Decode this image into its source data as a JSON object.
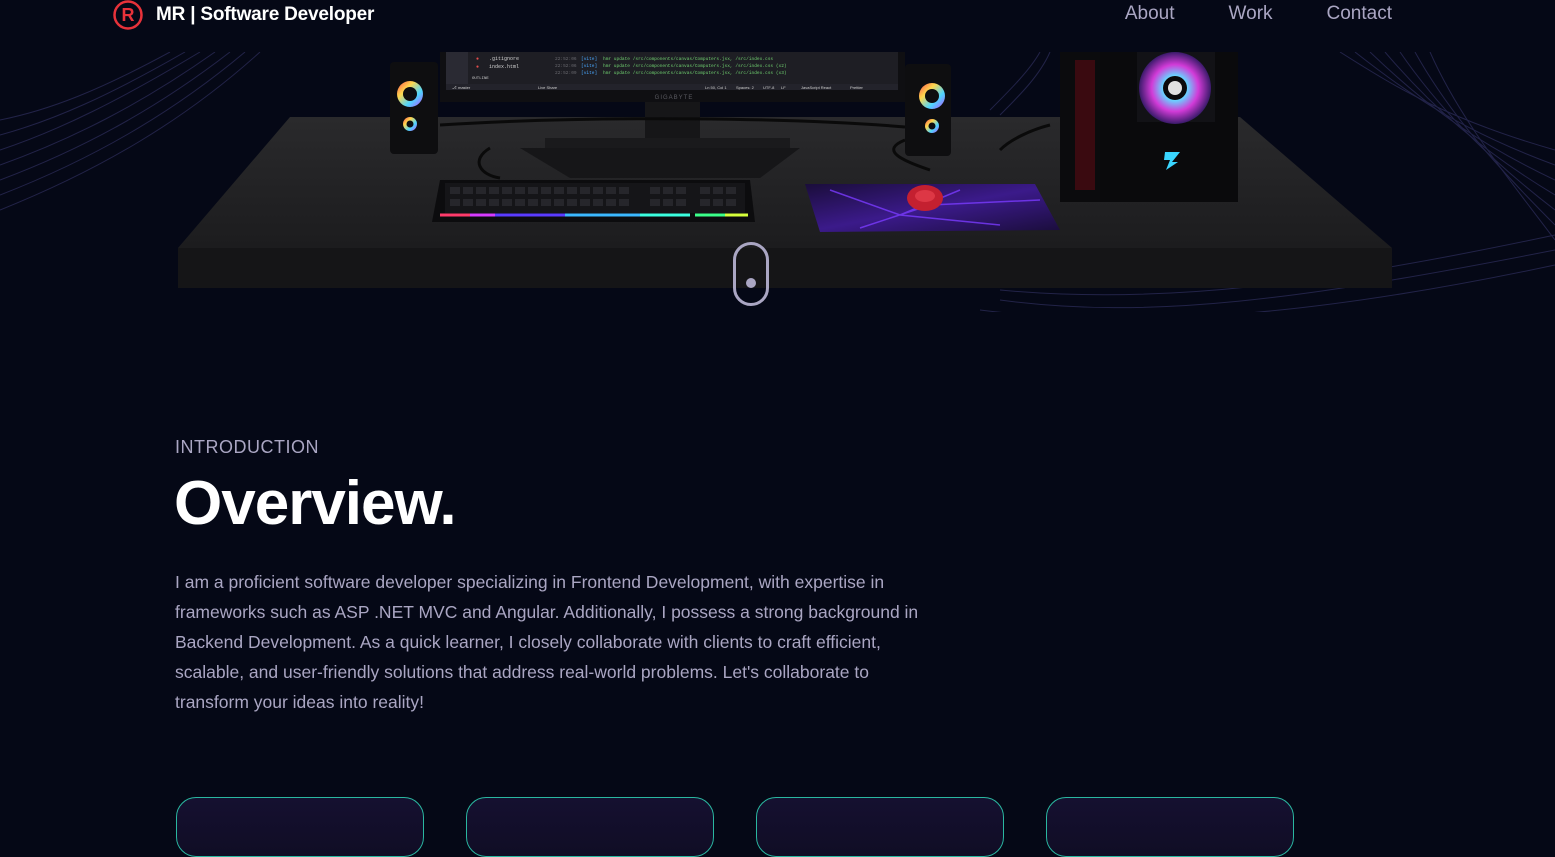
{
  "brand": {
    "logo_letter": "R",
    "initials": "MR",
    "title": " | Software Developer",
    "accent_color": "#e8323a"
  },
  "nav": {
    "links": [
      "About",
      "Work",
      "Contact"
    ]
  },
  "monitor": {
    "vendor": "GIGABYTE",
    "files": [
      ".gitignore",
      "index.html"
    ],
    "panel_label": "OUTLINE",
    "branch": "master",
    "live_share": "Live Share",
    "status_items": [
      "Ln 50, Col 1",
      "Spaces: 2",
      "UTF-8",
      "LF",
      "JavaScript React",
      "Prettier"
    ],
    "log_lines": [
      {
        "time": "22:52:06",
        "tag": "[vite]",
        "msg": "hmr update /src/components/canvas/Computers.jsx, /src/index.css"
      },
      {
        "time": "22:52:06",
        "tag": "[vite]",
        "msg": "hmr update /src/components/canvas/Computers.jsx, /src/index.css (x2)"
      },
      {
        "time": "22:52:09",
        "tag": "[vite]",
        "msg": "hmr update /src/components/canvas/Computers.jsx, /src/index.css (x3)"
      }
    ]
  },
  "introduction": {
    "label": "INTRODUCTION",
    "title": "Overview.",
    "text": "I am a proficient software developer specializing in Frontend Development, with expertise in frameworks such as ASP .NET MVC and Angular. Additionally, I possess a strong background in Backend Development. As a quick learner, I closely collaborate with clients to craft efficient, scalable, and user-friendly solutions that address real-world problems. Let's collaborate to transform your ideas into reality!"
  },
  "colors": {
    "background": "#050816",
    "secondary_text": "#aaa6c3",
    "card_border": "#2ab7a0",
    "card_fill": "#151030"
  }
}
